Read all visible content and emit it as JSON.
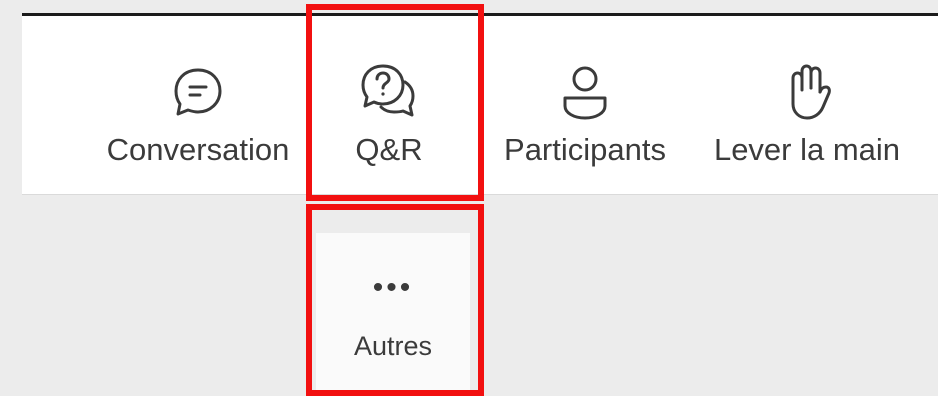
{
  "toolbar": {
    "items": [
      {
        "label": "Conversation",
        "icon": "chat-bubble-icon"
      },
      {
        "label": "Q&R",
        "icon": "question-answer-icon"
      },
      {
        "label": "Participants",
        "icon": "person-icon"
      },
      {
        "label": "Lever la main",
        "icon": "raise-hand-icon"
      }
    ]
  },
  "more": {
    "dots": "•••",
    "label": "Autres",
    "icon": "more-icon"
  },
  "colors": {
    "background": "#ececec",
    "toolbar": "#ffffff",
    "text": "#3b3b3b",
    "highlight": "#f21010",
    "top_rule": "#1b1b1b"
  }
}
